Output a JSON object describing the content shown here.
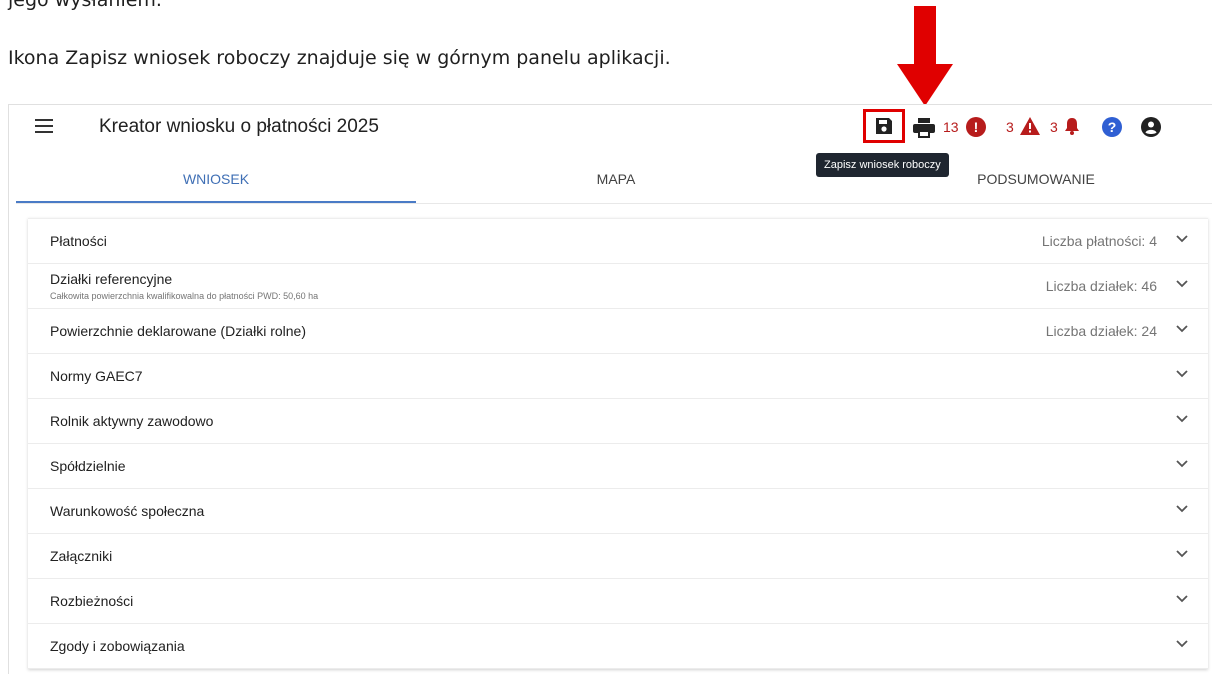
{
  "document": {
    "top_text": "jego wysłaniem.",
    "intro": "Ikona Zapisz wniosek roboczy znajduje się w górnym panelu aplikacji."
  },
  "app": {
    "title": "Kreator wniosku o płatności 2025",
    "toolbar": {
      "errors_count": "13",
      "warnings_count": "3",
      "notifications_count": "3",
      "save_tooltip": "Zapisz wniosek roboczy"
    },
    "tabs": [
      {
        "label": "WNIOSEK",
        "active": true
      },
      {
        "label": "MAPA",
        "active": false
      },
      {
        "label": "PODSUMOWANIE",
        "active": false
      }
    ],
    "sections": [
      {
        "label": "Płatności",
        "meta": "Liczba płatności: 4"
      },
      {
        "label": "Działki referencyjne",
        "sublabel": "Całkowita powierzchnia kwalifikowalna do płatności PWD: 50,60 ha",
        "meta": "Liczba działek: 46"
      },
      {
        "label": "Powierzchnie deklarowane (Działki rolne)",
        "meta": "Liczba działek: 24"
      },
      {
        "label": "Normy GAEC7"
      },
      {
        "label": "Rolnik aktywny zawodowo"
      },
      {
        "label": "Spółdzielnie"
      },
      {
        "label": "Warunkowość społeczna"
      },
      {
        "label": "Załączniki"
      },
      {
        "label": "Rozbieżności"
      },
      {
        "label": "Zgody i zobowiązania"
      }
    ]
  },
  "colors": {
    "annotation_red": "#e00000",
    "tab_active": "#4a7bc6",
    "error_red": "#b71c1c",
    "help_blue": "#2f5fd3"
  }
}
